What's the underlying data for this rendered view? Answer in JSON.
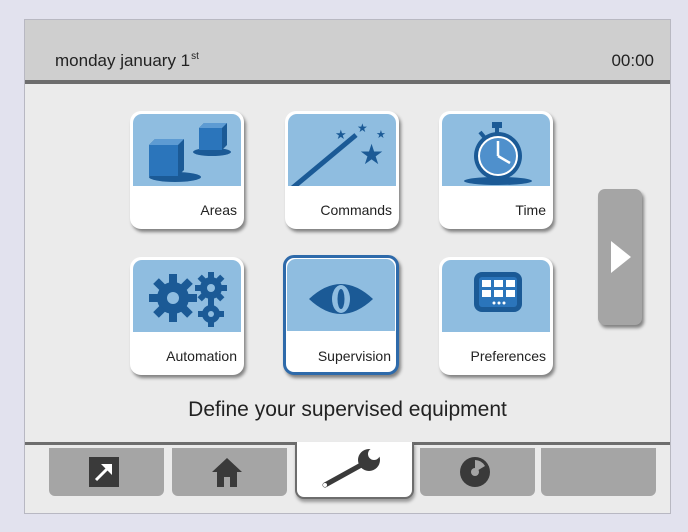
{
  "header": {
    "date_text": "monday january 1",
    "date_suffix": "st",
    "time": "00:00"
  },
  "tiles": [
    {
      "label": "Areas",
      "icon": "areas-cubes-icon"
    },
    {
      "label": "Commands",
      "icon": "magic-wand-icon"
    },
    {
      "label": "Time",
      "icon": "stopwatch-icon"
    },
    {
      "label": "Automation",
      "icon": "gears-icon"
    },
    {
      "label": "Supervision",
      "icon": "eye-icon",
      "selected": true
    },
    {
      "label": "Preferences",
      "icon": "keypad-icon"
    }
  ],
  "next_button": {
    "icon": "chevron-right-icon"
  },
  "message": "Define your supervised equipment",
  "tabs": [
    {
      "name": "shortcut",
      "icon": "arrow-up-right-icon"
    },
    {
      "name": "home",
      "icon": "home-icon"
    },
    {
      "name": "settings",
      "icon": "wrench-icon",
      "active": true
    },
    {
      "name": "media",
      "icon": "disc-icon"
    },
    {
      "name": "empty",
      "icon": ""
    }
  ],
  "colors": {
    "tile_art": "#8fbde0",
    "icon_blue": "#1b5a96",
    "selected_border": "#2e6aaa",
    "tab_gray": "#a5a5a5",
    "header": "#cfcfcf"
  }
}
